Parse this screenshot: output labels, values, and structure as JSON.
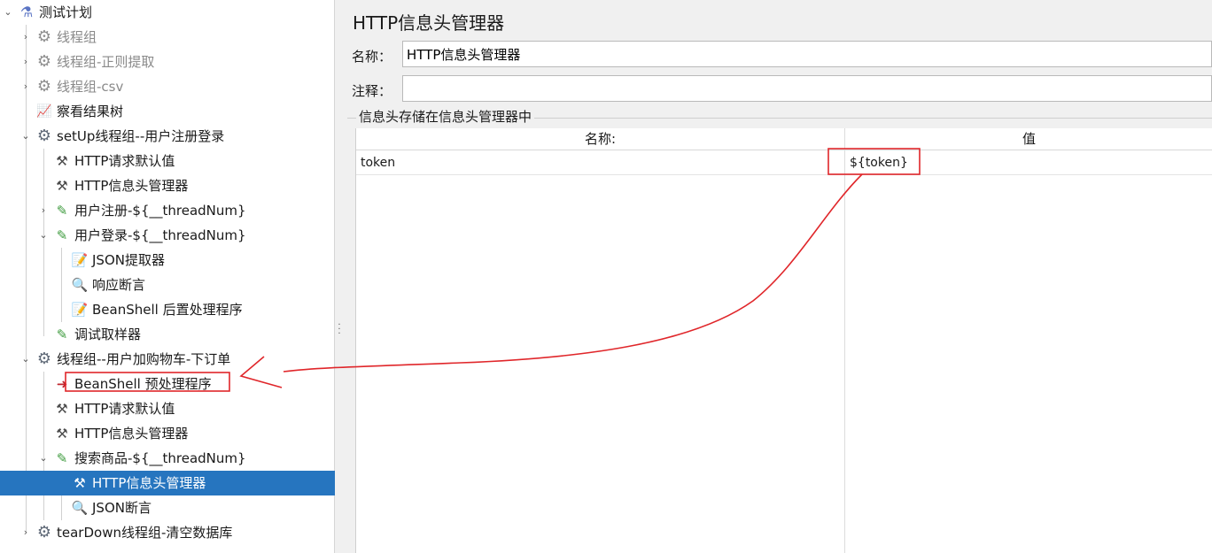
{
  "tree": {
    "items": [
      {
        "label": "测试计划",
        "icon": "flask-icon",
        "toggle": "v",
        "disabled": false
      },
      {
        "label": "线程组",
        "icon": "gear-icon",
        "toggle": ">",
        "disabled": true
      },
      {
        "label": "线程组-正则提取",
        "icon": "gear-icon",
        "toggle": ">",
        "disabled": true
      },
      {
        "label": "线程组-csv",
        "icon": "gear-icon",
        "toggle": ">",
        "disabled": true
      },
      {
        "label": "察看结果树",
        "icon": "chart-icon",
        "toggle": "",
        "disabled": false
      },
      {
        "label": "setUp线程组--用户注册登录",
        "icon": "gear-icon",
        "toggle": "v",
        "disabled": false
      },
      {
        "label": "HTTP请求默认值",
        "icon": "tools-icon",
        "toggle": "",
        "disabled": false
      },
      {
        "label": "HTTP信息头管理器",
        "icon": "tools-icon",
        "toggle": "",
        "disabled": false
      },
      {
        "label": "用户注册-${__threadNum}",
        "icon": "sampler-pen-icon",
        "toggle": ">",
        "disabled": false
      },
      {
        "label": "用户登录-${__threadNum}",
        "icon": "sampler-pen-icon",
        "toggle": "v",
        "disabled": false
      },
      {
        "label": "JSON提取器",
        "icon": "document-arrow-icon",
        "toggle": "",
        "disabled": false
      },
      {
        "label": "响应断言",
        "icon": "magnifier-icon",
        "toggle": "",
        "disabled": false
      },
      {
        "label": "BeanShell 后置处理程序",
        "icon": "document-arrow-icon",
        "toggle": "",
        "disabled": false
      },
      {
        "label": "调试取样器",
        "icon": "sampler-pen-icon",
        "toggle": "",
        "disabled": false
      },
      {
        "label": "线程组--用户加购物车-下订单",
        "icon": "gear-icon",
        "toggle": "v",
        "disabled": false
      },
      {
        "label": "BeanShell 预处理程序",
        "icon": "preprocessor-arrow-icon",
        "toggle": "",
        "disabled": false
      },
      {
        "label": "HTTP请求默认值",
        "icon": "tools-icon",
        "toggle": "",
        "disabled": false
      },
      {
        "label": "HTTP信息头管理器",
        "icon": "tools-icon",
        "toggle": "",
        "disabled": false
      },
      {
        "label": "搜索商品-${__threadNum}",
        "icon": "sampler-pen-icon",
        "toggle": "v",
        "disabled": false
      },
      {
        "label": "HTTP信息头管理器",
        "icon": "tools-icon",
        "toggle": "",
        "disabled": false,
        "selected": true
      },
      {
        "label": "JSON断言",
        "icon": "magnifier-icon",
        "toggle": "",
        "disabled": false
      },
      {
        "label": "tearDown线程组-清空数据库",
        "icon": "gear-icon",
        "toggle": ">",
        "disabled": false
      }
    ]
  },
  "panel": {
    "title": "HTTP信息头管理器",
    "name_label": "名称：",
    "name_value": "HTTP信息头管理器",
    "comment_label": "注释：",
    "comment_value": "",
    "group_title": "信息头存储在信息头管理器中",
    "table": {
      "headers": [
        "名称:",
        "值"
      ],
      "rows": [
        [
          "token",
          "${token}"
        ]
      ]
    }
  },
  "colors": {
    "selection": "#2675bf",
    "annotation": "#e0262a",
    "panel_bg": "#f0f0f0"
  }
}
